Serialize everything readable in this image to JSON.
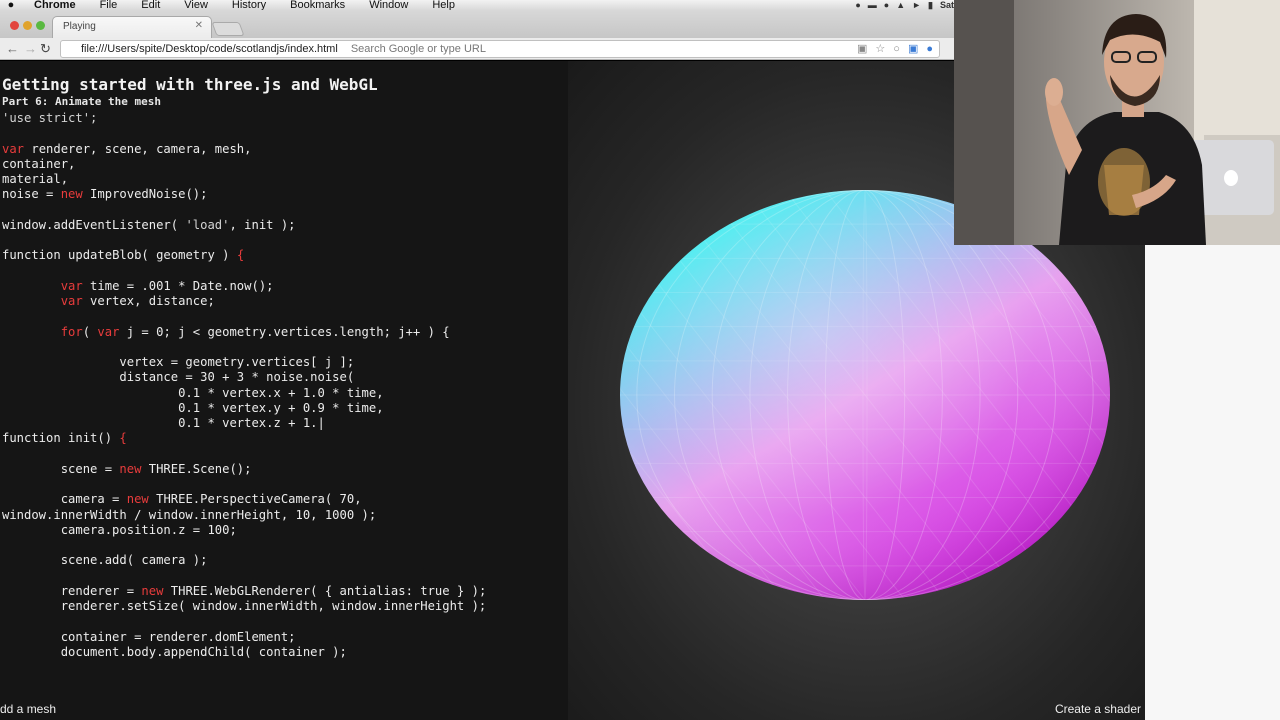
{
  "menubar": {
    "app_name": "Chrome",
    "items": [
      "File",
      "Edit",
      "View",
      "History",
      "Bookmarks",
      "Window",
      "Help"
    ],
    "clock_partial": "Sat"
  },
  "browser": {
    "tab_title": "Playing",
    "url": "file:///Users/spite/Desktop/code/scotlandjs/index.html",
    "omnibox_hint": "Search Google or type URL"
  },
  "slide": {
    "title": "Getting started with three.js and WebGL",
    "subtitle": "Part 6: Animate the mesh",
    "code_lines": [
      [
        {
          "t": "'use strict';",
          "c": "str"
        }
      ],
      [],
      [
        {
          "t": "var",
          "c": "kw"
        },
        {
          "t": " renderer, scene, camera, mesh,"
        }
      ],
      [
        {
          "t": "container,"
        }
      ],
      [
        {
          "t": "material,"
        }
      ],
      [
        {
          "t": "noise = "
        },
        {
          "t": "new",
          "c": "kw"
        },
        {
          "t": " ImprovedNoise();"
        }
      ],
      [],
      [
        {
          "t": "window.addEventListener( "
        },
        {
          "t": "'load'",
          "c": "str"
        },
        {
          "t": ", init );"
        }
      ],
      [],
      [
        {
          "t": "function",
          "c": "fn"
        },
        {
          "t": " updateBlob( geometry ) "
        },
        {
          "t": "{",
          "c": "kw"
        }
      ],
      [],
      [
        {
          "t": "        "
        },
        {
          "t": "var",
          "c": "kw"
        },
        {
          "t": " time = .001 * Date.now();"
        }
      ],
      [
        {
          "t": "        "
        },
        {
          "t": "var",
          "c": "kw"
        },
        {
          "t": " vertex, distance;"
        }
      ],
      [],
      [
        {
          "t": "        "
        },
        {
          "t": "for",
          "c": "kw"
        },
        {
          "t": "( "
        },
        {
          "t": "var",
          "c": "kw"
        },
        {
          "t": " j = 0; j < geometry.vertices.length; j++ ) {"
        }
      ],
      [],
      [
        {
          "t": "                vertex = geometry.vertices[ j ];"
        }
      ],
      [
        {
          "t": "                distance = 30 + 3 * noise.noise("
        }
      ],
      [
        {
          "t": "                        0.1 * vertex.x + 1.0 * time,"
        }
      ],
      [
        {
          "t": "                        0.1 * vertex.y + 0.9 * time,"
        }
      ],
      [
        {
          "t": "                        0.1 * vertex.z + 1.|"
        }
      ],
      [
        {
          "t": "function",
          "c": "fn"
        },
        {
          "t": " init() "
        },
        {
          "t": "{",
          "c": "kw"
        }
      ],
      [],
      [
        {
          "t": "        scene = "
        },
        {
          "t": "new",
          "c": "kw"
        },
        {
          "t": " THREE.Scene();"
        }
      ],
      [],
      [
        {
          "t": "        camera = "
        },
        {
          "t": "new",
          "c": "kw"
        },
        {
          "t": " THREE.PerspectiveCamera( 70,"
        }
      ],
      [
        {
          "t": "window.innerWidth / window.innerHeight, 10, 1000 );"
        }
      ],
      [
        {
          "t": "        camera.position.z = 100;"
        }
      ],
      [],
      [
        {
          "t": "        scene.add( camera );"
        }
      ],
      [],
      [
        {
          "t": "        renderer = "
        },
        {
          "t": "new",
          "c": "kw"
        },
        {
          "t": " THREE.WebGLRenderer( { antialias: true } );"
        }
      ],
      [
        {
          "t": "        renderer.setSize( window.innerWidth, window.innerHeight );"
        }
      ],
      [],
      [
        {
          "t": "        container = renderer.domElement;"
        }
      ],
      [
        {
          "t": "        document.body.appendChild( container );"
        }
      ]
    ],
    "prev_link": "dd a mesh",
    "next_link": "Create a shader"
  },
  "colors": {
    "code_bg": "#151515",
    "keyword": "#e83c3c",
    "blob_top": "#3ff0f0",
    "blob_mid": "#e8a0f0",
    "blob_bottom": "#d020e0"
  }
}
